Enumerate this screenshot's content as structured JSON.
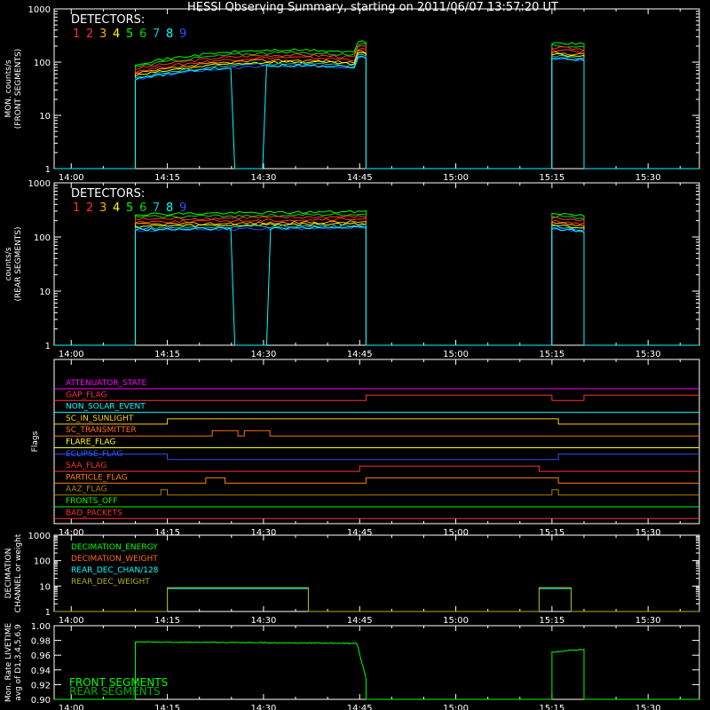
{
  "title": "HESSI Observing Summary, starting on 2011/06/07 13:57:20 UT",
  "time_ticks": [
    "14:00",
    "14:15",
    "14:30",
    "14:45",
    "15:00",
    "15:15",
    "15:30"
  ],
  "detector_colors": [
    "#ff3030",
    "#ff3030",
    "#ffb000",
    "#ffff00",
    "#00ff00",
    "#00d800",
    "#00c8c8",
    "#00ffff",
    "#3050ff"
  ],
  "chart_data": [
    {
      "type": "line",
      "panel": "front",
      "ylabel_lines": [
        "MON. counts/s",
        "(FRONT SEGMENTS)"
      ],
      "yticks": [
        "1",
        "10",
        "100",
        "1000"
      ],
      "ylim": [
        1,
        1000
      ],
      "yscale": "log",
      "legend_title": "DETECTORS:",
      "legend_labels": [
        "1",
        "2",
        "3",
        "4",
        "5",
        "6",
        "7",
        "8",
        "9"
      ],
      "x_range": [
        "13:57:20",
        "15:38:00"
      ],
      "segments": [
        {
          "start": "14:10",
          "end": "14:46",
          "level_start": 60,
          "level_end": 95
        },
        {
          "start": "15:15",
          "end": "15:20",
          "level_start": 150,
          "level_end": 140
        }
      ],
      "dropout": {
        "start": "14:25",
        "end": "14:30",
        "series": "8"
      }
    },
    {
      "type": "line",
      "panel": "rear",
      "ylabel_lines": [
        "counts/s",
        "(REAR SEGMENTS)"
      ],
      "yticks": [
        "1",
        "10",
        "100",
        "1000"
      ],
      "ylim": [
        1,
        1000
      ],
      "yscale": "log",
      "legend_title": "DETECTORS:",
      "legend_labels": [
        "1",
        "2",
        "3",
        "4",
        "5",
        "6",
        "7",
        "8",
        "9"
      ],
      "segments": [
        {
          "start": "14:10",
          "end": "14:46",
          "level_start": 170,
          "level_end": 190
        },
        {
          "start": "15:15",
          "end": "15:20",
          "level_start": 180,
          "level_end": 160
        }
      ],
      "dropout": {
        "start": "14:25",
        "end": "14:31",
        "series": "8"
      }
    },
    {
      "type": "line",
      "panel": "flags",
      "ylabel": "Flags",
      "flags": [
        {
          "name": "ATTENUATOR_STATE",
          "color": "#ff00ff"
        },
        {
          "name": "GAP_FLAG",
          "color": "#ff3030"
        },
        {
          "name": "NON_SOLAR_EVENT",
          "color": "#00ffff"
        },
        {
          "name": "SC_IN_SUNLIGHT",
          "color": "#ffd000"
        },
        {
          "name": "SC_TRANSMITTER",
          "color": "#ff6a20"
        },
        {
          "name": "FLARE_FLAG",
          "color": "#ffff00"
        },
        {
          "name": "ECLIPSE_FLAG",
          "color": "#3050ff"
        },
        {
          "name": "SAA_FLAG",
          "color": "#ff3030"
        },
        {
          "name": "PARTICLE_FLAG",
          "color": "#ff8000"
        },
        {
          "name": "AAZ_FLAG",
          "color": "#b08000"
        },
        {
          "name": "FRONTS_OFF",
          "color": "#00ff00"
        },
        {
          "name": "BAD_PACKETS",
          "color": "#ff3030"
        }
      ]
    },
    {
      "type": "line",
      "panel": "decimation",
      "ylabel_lines": [
        "DECIMATION",
        "CHANNEL or weight"
      ],
      "yticks": [
        "1",
        "10",
        "100",
        "1000"
      ],
      "ylim": [
        1,
        1000
      ],
      "yscale": "log",
      "legend": [
        {
          "name": "DECIMATION_ENERGY",
          "color": "#00ff00"
        },
        {
          "name": "DECIMATION_WEIGHT",
          "color": "#ff6a20"
        },
        {
          "name": "REAR_DEC_CHAN/128",
          "color": "#00ffff"
        },
        {
          "name": "REAR_DEC_WEIGHT",
          "color": "#b0b000"
        }
      ],
      "series": [
        {
          "name": "REAR_DEC_CHAN/128",
          "segments": [
            [
              "14:15",
              "14:37",
              8
            ],
            [
              "15:13",
              "15:18",
              8
            ]
          ]
        },
        {
          "name": "REAR_DEC_WEIGHT",
          "segments": [
            [
              "14:15",
              "14:37",
              8
            ],
            [
              "15:13",
              "15:18",
              8
            ]
          ]
        }
      ]
    },
    {
      "type": "line",
      "panel": "livetime",
      "ylabel_lines": [
        "Mon. Rate LIVETIME",
        "avg of D1,3,4,5,6,9"
      ],
      "yticks": [
        "0.90",
        "0.92",
        "0.94",
        "0.96",
        "0.98",
        "1.00"
      ],
      "ylim": [
        0.9,
        1.0
      ],
      "legend": [
        {
          "name": "FRONT SEGMENTS",
          "color": "#00ff00"
        },
        {
          "name": "REAR SEGMENTS",
          "color": "#00b000"
        }
      ],
      "segments": [
        {
          "start": "14:10",
          "end": "14:46",
          "level_start": 0.978,
          "level_end": 0.976
        },
        {
          "start": "15:15",
          "end": "15:20",
          "level_start": 0.964,
          "level_end": 0.968
        }
      ]
    }
  ]
}
